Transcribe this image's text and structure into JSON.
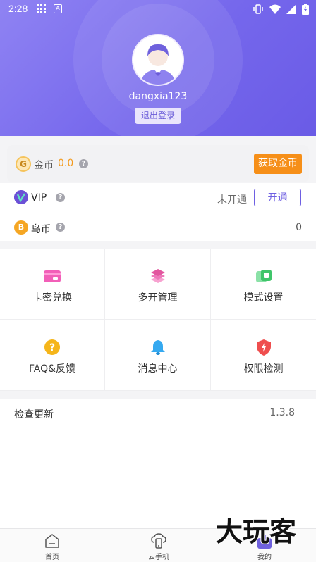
{
  "status_bar": {
    "time": "2:28"
  },
  "profile": {
    "username": "dangxia123",
    "logout_label": "退出登录"
  },
  "coins": {
    "icon_letter": "G",
    "label": "金币",
    "value": "0.0",
    "help": "?",
    "get_button": "获取金币"
  },
  "vip": {
    "label": "VIP",
    "help": "?",
    "status": "未开通",
    "open_button": "开通"
  },
  "bird_coin": {
    "icon_letter": "B",
    "label": "鸟币",
    "help": "?",
    "value": "0"
  },
  "grid": {
    "items": [
      {
        "label": "卡密兑换",
        "icon": "card-redeem-icon",
        "color": "#f25fb8"
      },
      {
        "label": "多开管理",
        "icon": "layers-icon",
        "color": "#e85aa8"
      },
      {
        "label": "模式设置",
        "icon": "mode-icon",
        "color": "#3fc56a"
      },
      {
        "label": "FAQ&反馈",
        "icon": "question-icon",
        "color": "#f5b51a"
      },
      {
        "label": "消息中心",
        "icon": "bell-icon",
        "color": "#35a9f0"
      },
      {
        "label": "权限检测",
        "icon": "shield-icon",
        "color": "#ef4e4e"
      }
    ]
  },
  "update": {
    "label": "检查更新",
    "version": "1.3.8"
  },
  "nav": {
    "items": [
      {
        "label": "首页",
        "icon": "home-icon"
      },
      {
        "label": "云手机",
        "icon": "cloud-phone-icon"
      },
      {
        "label": "我的",
        "icon": "profile-icon",
        "active": true
      }
    ]
  },
  "watermark": "大玩客",
  "colors": {
    "accent": "#7567ec",
    "coin": "#f39a1d",
    "button_orange": "#f68f18"
  }
}
